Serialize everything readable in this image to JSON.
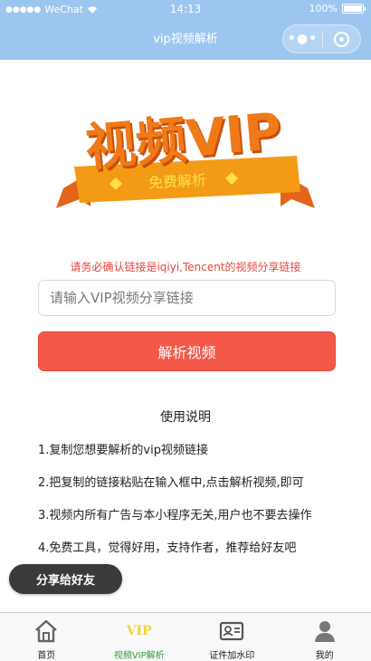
{
  "status_bar": {
    "carrier": "WeChat",
    "time": "14:13",
    "battery": "100%"
  },
  "nav": {
    "title": "vip视频解析",
    "more_icon": "more-dots-icon",
    "close_icon": "mini-program-close-icon"
  },
  "logo": {
    "main_text": "视频VIP",
    "ribbon_text": "免费解析",
    "colors": {
      "main": "#f07a18",
      "ribbon": "#f39a16",
      "diamond": "#ffe14a"
    }
  },
  "form": {
    "notice": "请务必确认链接是iqiyi,Tencent的视频分享链接",
    "input_placeholder": "请输入VIP视频分享链接",
    "input_value": "",
    "parse_button": "解析视频"
  },
  "instructions": {
    "title": "使用说明",
    "items": [
      "1.复制您想要解析的vip视频链接",
      "2.把复制的链接粘贴在输入框中,点击解析视频,即可",
      "3.视频内所有广告与本小程序无关,用户也不要去操作",
      "4.免费工具，觉得好用，支持作者，推荐给好友吧"
    ]
  },
  "share_button": "分享给好友",
  "tabbar": {
    "active_index": 1,
    "items": [
      {
        "label": "首页",
        "icon": "home-icon"
      },
      {
        "label": "视频VIP解析",
        "icon": "vip-icon",
        "icon_text": "VIP"
      },
      {
        "label": "证件加水印",
        "icon": "id-card-icon"
      },
      {
        "label": "我的",
        "icon": "user-icon"
      }
    ],
    "active_color": "#2d9b3a"
  },
  "colors": {
    "nav_bg": "#9cc6ef",
    "primary_button": "#f4584a",
    "notice_text": "#e8463a"
  }
}
